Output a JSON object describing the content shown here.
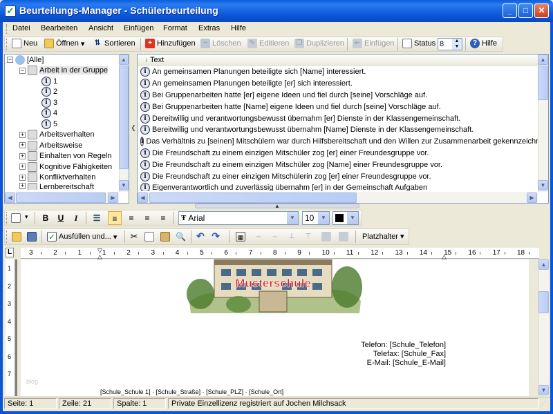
{
  "window": {
    "title": "Beurteilungs-Manager - Schülerbeurteilung",
    "minimize": "_",
    "maximize": "□",
    "close": "✕"
  },
  "menu": [
    "Datei",
    "Bearbeiten",
    "Ansicht",
    "Einfügen",
    "Format",
    "Extras",
    "Hilfe"
  ],
  "toolbar": {
    "new": "Neu",
    "open": "Öffnen",
    "sort": "Sortieren",
    "add": "Hinzufügen",
    "delete": "Löschen",
    "edit": "Editieren",
    "duplicate": "Duplizieren",
    "insert": "Einfügen",
    "status_label": "Status",
    "status_value": "8",
    "help": "Hilfe"
  },
  "tree": {
    "root": "[Alle]",
    "group": "Arbeit in der Gruppe",
    "children": [
      "1",
      "2",
      "3",
      "4",
      "5"
    ],
    "categories": [
      "Arbeitsverhalten",
      "Arbeitsweise",
      "Einhalten von Regeln",
      "Kognitive Fähigkeiten",
      "Konfliktverhalten",
      "Lernbereitschaft"
    ]
  },
  "text_list": {
    "header": "Text",
    "rows": [
      "An gemeinsamen Planungen beteiligte sich [Name] interessiert.",
      "An gemeinsamen Planungen beteiligte [er] sich interessiert.",
      "Bei Gruppenarbeiten hatte [er] eigene Ideen und fiel durch [seine] Vorschläge auf.",
      "Bei Gruppenarbeiten hatte [Name] eigene Ideen und fiel durch [seine] Vorschläge auf.",
      "Dereitwillig und verantwortungsbewusst übernahm [er] Dienste in der Klassengemeinschaft.",
      "Bereitwillig und verantwortungsbewusst übernahm [Name] Dienste in der Klassengemeinschaft.",
      "Das Verhältnis zu [seinen] Mitschülern war durch Hilfsbereitschaft und den Willen zur Zusammenarbeit gekennzeichne",
      "Die Freundschaft zu einem einzigen Mitschüler zog [er] einer Freundesgruppe vor.",
      "Die Freundschaft zu einem einzigen Mitschüler zog [Name] einer Freundesgruppe vor.",
      "Die Freundschaft zu einer einzigen Mitschülerin zog [er] einer Freundesgruppe vor.",
      "Eigenverantwortlich und zuverlässig übernahm [er] in der Gemeinschaft Aufgaben"
    ]
  },
  "format": {
    "font": "Arial",
    "size": "10"
  },
  "toolbar2": {
    "fill": "Ausfüllen und...",
    "placeholder": "Platzhalter"
  },
  "ruler": {
    "ticks": [
      "3",
      "2",
      "1",
      "1",
      "2",
      "3",
      "4",
      "5",
      "6",
      "7",
      "8",
      "9",
      "10",
      "11",
      "12",
      "13",
      "14",
      "15",
      "16",
      "17",
      "18"
    ]
  },
  "vruler": [
    "1",
    "2",
    "3",
    "4",
    "5",
    "6",
    "7"
  ],
  "document": {
    "logo_text": "Musterschule",
    "phone": "Telefon: [Schule_Telefon]",
    "fax": "Telefax: [Schule_Fax]",
    "email": "E-Mail: [Schule_E-Mail]",
    "address": "[Schule_Schule 1] · [Schule_Straße] · [Schule_PLZ] · [Schule_Ort]",
    "watermark": "blog"
  },
  "status": {
    "page": "Seite: 1",
    "line": "Zeile: 21",
    "column": "Spalte: 1",
    "license": "Private Einzellizenz registriert auf Jochen Milchsack"
  },
  "colors": {
    "titlebar": "#0b56d8",
    "accent": "#316ac5",
    "logo_red": "#d81e1e"
  }
}
